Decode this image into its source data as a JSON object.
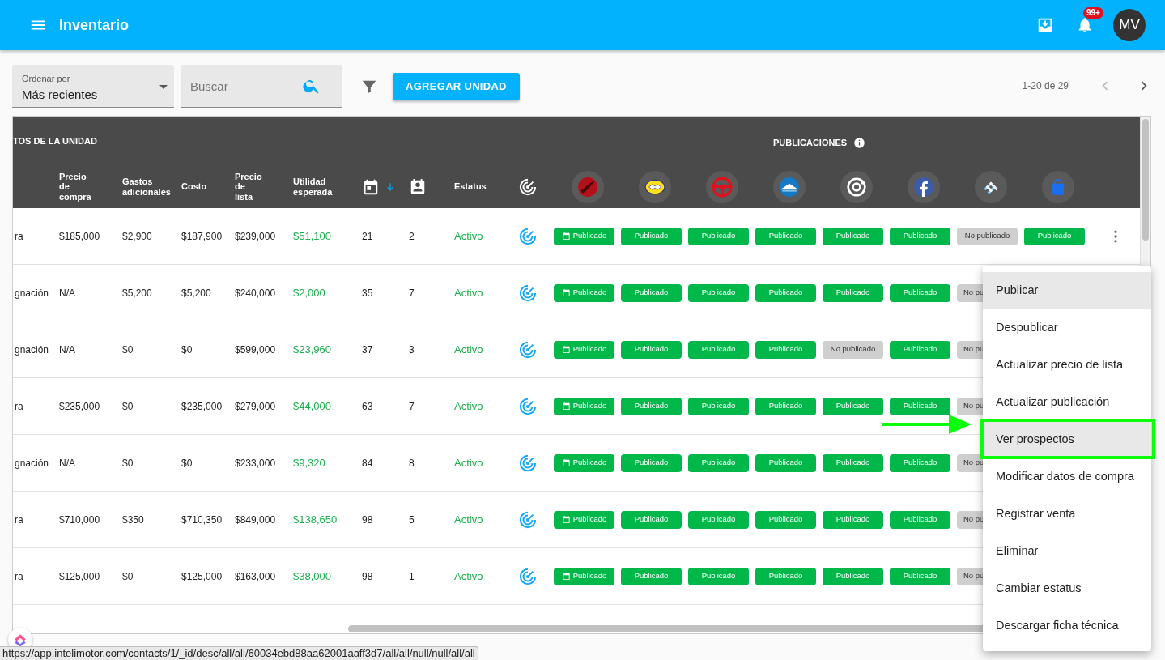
{
  "app_bar": {
    "title": "Inventario",
    "notification_count": "99+",
    "avatar_initials": "MV"
  },
  "toolbar": {
    "sort": {
      "label": "Ordenar por",
      "value": "Más recientes"
    },
    "search": {
      "placeholder": "Buscar"
    },
    "add_button": "AGREGAR UNIDAD",
    "pagination": {
      "range": "1-20 de 29",
      "prev_disabled": true,
      "next_disabled": false
    }
  },
  "table": {
    "group_headers": [
      "TOS DE LA UNIDAD",
      "PUBLICACIONES"
    ],
    "columns": [
      {
        "kind": "blank"
      },
      {
        "kind": "text",
        "label": "Precio de compra"
      },
      {
        "kind": "text",
        "label": "Gastos adicionales"
      },
      {
        "kind": "text",
        "label": "Costo"
      },
      {
        "kind": "text",
        "label": "Precio de lista"
      },
      {
        "kind": "text",
        "label": "Utilidad esperada"
      },
      {
        "kind": "calendar",
        "sorted_descending": true
      },
      {
        "kind": "prospects"
      },
      {
        "kind": "text",
        "label": "Estatus"
      },
      {
        "kind": "radar"
      }
    ],
    "platforms": [
      {
        "kind": "sphere"
      },
      {
        "kind": "handshake"
      },
      {
        "kind": "wheel"
      },
      {
        "kind": "roof"
      },
      {
        "kind": "ring"
      },
      {
        "kind": "f"
      },
      {
        "kind": "stripes"
      },
      {
        "kind": "bag"
      }
    ],
    "rows": [
      {
        "column_1": "ra",
        "purchase_price": "$185,000",
        "extra_costs": "$2,900",
        "cost": "$187,900",
        "list_price": "$239,000",
        "expected_profit": "$51,100",
        "days": "21",
        "prospects": "2",
        "status": "Activo",
        "menu_button": true,
        "publications": [
          {
            "label": "Publicado",
            "published": true,
            "scheduled": true
          },
          {
            "label": "Publicado",
            "published": true
          },
          {
            "label": "Publicado",
            "published": true
          },
          {
            "label": "Publicado",
            "published": true
          },
          {
            "label": "Publicado",
            "published": true
          },
          {
            "label": "Publicado",
            "published": true
          },
          {
            "label": "No publicado",
            "published": false
          },
          {
            "label": "Publicado",
            "published": true
          }
        ]
      },
      {
        "column_1": "gnación",
        "purchase_price": "N/A",
        "extra_costs": "$5,200",
        "cost": "$5,200",
        "list_price": "$240,000",
        "expected_profit": "$2,000",
        "days": "35",
        "prospects": "7",
        "status": "Activo",
        "publications": [
          {
            "label": "Publicado",
            "published": true,
            "scheduled": true
          },
          {
            "label": "Publicado",
            "published": true
          },
          {
            "label": "Publicado",
            "published": true
          },
          {
            "label": "Publicado",
            "published": true
          },
          {
            "label": "Publicado",
            "published": true
          },
          {
            "label": "Publicado",
            "published": true
          },
          {
            "label": "No pu",
            "published": false,
            "truncated": true
          }
        ]
      },
      {
        "column_1": "gnación",
        "purchase_price": "N/A",
        "extra_costs": "$0",
        "cost": "$0",
        "list_price": "$599,000",
        "expected_profit": "$23,960",
        "days": "37",
        "prospects": "3",
        "status": "Activo",
        "publications": [
          {
            "label": "Publicado",
            "published": true,
            "scheduled": true
          },
          {
            "label": "Publicado",
            "published": true
          },
          {
            "label": "Publicado",
            "published": true
          },
          {
            "label": "Publicado",
            "published": true
          },
          {
            "label": "No publicado",
            "published": false
          },
          {
            "label": "Publicado",
            "published": true
          },
          {
            "label": "No pu",
            "published": false,
            "truncated": true
          }
        ]
      },
      {
        "column_1": "ra",
        "purchase_price": "$235,000",
        "extra_costs": "$0",
        "cost": "$235,000",
        "list_price": "$279,000",
        "expected_profit": "$44,000",
        "days": "63",
        "prospects": "7",
        "status": "Activo",
        "publications": [
          {
            "label": "Publicado",
            "published": true,
            "scheduled": true
          },
          {
            "label": "Publicado",
            "published": true
          },
          {
            "label": "Publicado",
            "published": true
          },
          {
            "label": "Publicado",
            "published": true
          },
          {
            "label": "Publicado",
            "published": true
          },
          {
            "label": "Publicado",
            "published": true
          },
          {
            "label": "No pu",
            "published": false,
            "truncated": true
          }
        ]
      },
      {
        "column_1": "gnación",
        "purchase_price": "N/A",
        "extra_costs": "$0",
        "cost": "$0",
        "list_price": "$233,000",
        "expected_profit": "$9,320",
        "days": "84",
        "prospects": "8",
        "status": "Activo",
        "publications": [
          {
            "label": "Publicado",
            "published": true,
            "scheduled": true
          },
          {
            "label": "Publicado",
            "published": true
          },
          {
            "label": "Publicado",
            "published": true
          },
          {
            "label": "Publicado",
            "published": true
          },
          {
            "label": "Publicado",
            "published": true
          },
          {
            "label": "Publicado",
            "published": true
          },
          {
            "label": "No pu",
            "published": false,
            "truncated": true
          }
        ]
      },
      {
        "column_1": "ra",
        "purchase_price": "$710,000",
        "extra_costs": "$350",
        "cost": "$710,350",
        "list_price": "$849,000",
        "expected_profit": "$138,650",
        "days": "98",
        "prospects": "5",
        "status": "Activo",
        "publications": [
          {
            "label": "Publicado",
            "published": true,
            "scheduled": true
          },
          {
            "label": "Publicado",
            "published": true
          },
          {
            "label": "Publicado",
            "published": true
          },
          {
            "label": "Publicado",
            "published": true
          },
          {
            "label": "Publicado",
            "published": true
          },
          {
            "label": "Publicado",
            "published": true
          },
          {
            "label": "No pu",
            "published": false,
            "truncated": true
          }
        ]
      },
      {
        "column_1": "ra",
        "purchase_price": "$125,000",
        "extra_costs": "$0",
        "cost": "$125,000",
        "list_price": "$163,000",
        "expected_profit": "$38,000",
        "days": "98",
        "prospects": "1",
        "status": "Activo",
        "publications": [
          {
            "label": "Publicado",
            "published": true,
            "scheduled": true
          },
          {
            "label": "Publicado",
            "published": true
          },
          {
            "label": "Publicado",
            "published": true
          },
          {
            "label": "Publicado",
            "published": true
          },
          {
            "label": "Publicado",
            "published": true
          },
          {
            "label": "Publicado",
            "published": true
          },
          {
            "label": "No pu",
            "published": false,
            "truncated": true
          }
        ]
      }
    ]
  },
  "context_menu": {
    "items": [
      {
        "label": "Publicar",
        "highlighted": true,
        "annotated": false
      },
      {
        "label": "Despublicar",
        "highlighted": false,
        "annotated": false
      },
      {
        "label": "Actualizar precio de lista",
        "highlighted": false,
        "annotated": false
      },
      {
        "label": "Actualizar publicación",
        "highlighted": false,
        "annotated": false
      },
      {
        "label": "Ver prospectos",
        "highlighted": true,
        "annotated": true
      },
      {
        "label": "Modificar datos de compra",
        "highlighted": false,
        "annotated": false
      },
      {
        "label": "Registrar venta",
        "highlighted": false,
        "annotated": false
      },
      {
        "label": "Eliminar",
        "highlighted": false,
        "annotated": false
      },
      {
        "label": "Cambiar estatus",
        "highlighted": false,
        "annotated": false
      },
      {
        "label": "Descargar ficha técnica",
        "highlighted": false,
        "annotated": false
      }
    ]
  },
  "status_bar": {
    "url": "https://app.intelimotor.com/contacts/1/_id/desc/all/all/60034ebd88aa62001aaff3d7/all/all/null/null/all/all"
  }
}
